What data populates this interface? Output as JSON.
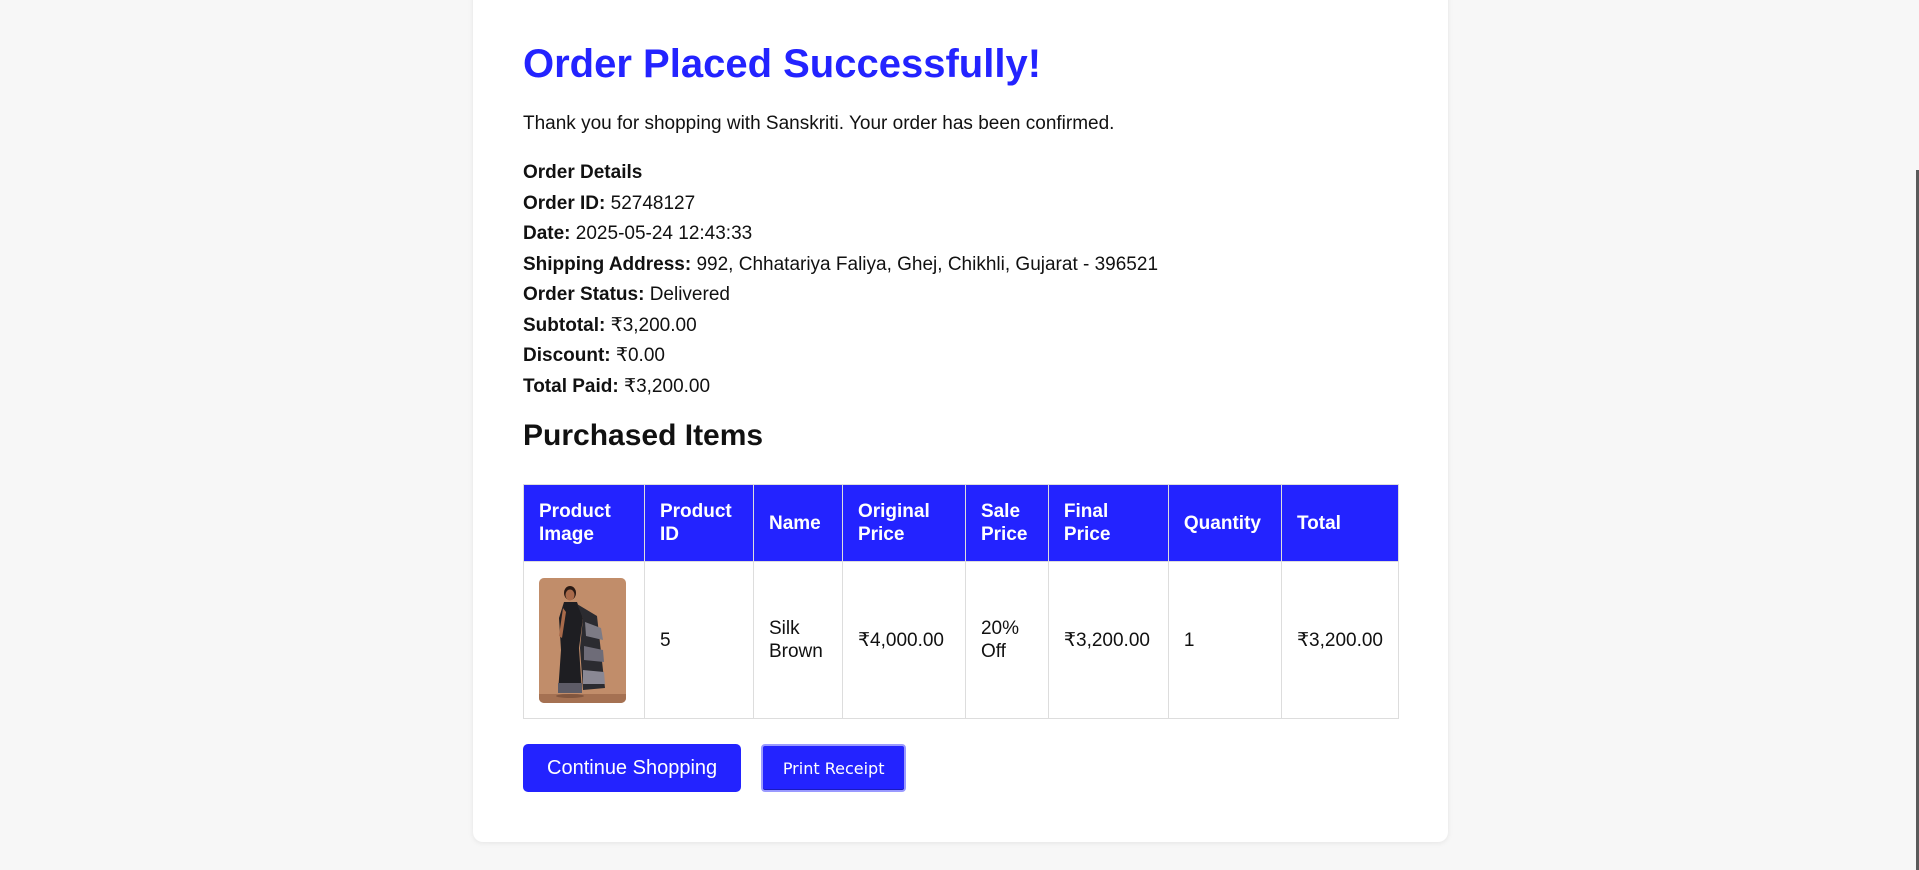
{
  "header": {
    "title": "Order Placed Successfully!",
    "intro": "Thank you for shopping with Sanskriti. Your order has been confirmed."
  },
  "order_details": {
    "heading": "Order Details",
    "order_id_label": "Order ID:",
    "order_id": "52748127",
    "date_label": "Date:",
    "date": "2025-05-24 12:43:33",
    "shipping_label": "Shipping Address:",
    "shipping_address": "992, Chhatariya Faliya, Ghej, Chikhli, Gujarat - 396521",
    "status_label": "Order Status:",
    "status": "Delivered",
    "subtotal_label": "Subtotal:",
    "subtotal": "₹3,200.00",
    "discount_label": "Discount:",
    "discount": "₹0.00",
    "total_label": "Total Paid:",
    "total": "₹3,200.00"
  },
  "items_section": {
    "title": "Purchased Items",
    "columns": [
      "Product Image",
      "Product ID",
      "Name",
      "Original Price",
      "Sale Price",
      "Final Price",
      "Quantity",
      "Total"
    ],
    "rows": [
      {
        "product_id": "5",
        "name": "Silk Brown",
        "original_price": "₹4,000.00",
        "sale_price": "20% Off",
        "final_price": "₹3,200.00",
        "quantity": "1",
        "total": "₹3,200.00"
      }
    ]
  },
  "actions": {
    "continue_label": "Continue Shopping",
    "print_label": "Print Receipt"
  },
  "colors": {
    "accent": "#2323ff",
    "background": "#f7f7f7"
  },
  "icons": {
    "product_thumbnail": "saree-product-image"
  }
}
